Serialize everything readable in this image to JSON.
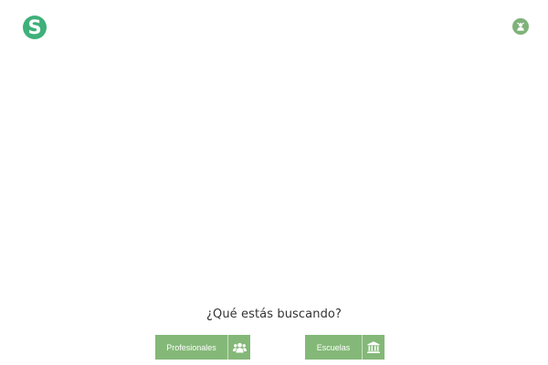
{
  "header": {
    "logo_letter": "S",
    "user_icon": "user-circle-icon"
  },
  "main": {
    "question": "¿Qué estás buscando?",
    "options": [
      {
        "label": "Profesionales",
        "icon": "users-group-icon"
      },
      {
        "label": "Escuelas",
        "icon": "institution-building-icon"
      }
    ]
  },
  "colors": {
    "brand": "#3fb07a",
    "button": "#84b878",
    "text": "#333333"
  }
}
